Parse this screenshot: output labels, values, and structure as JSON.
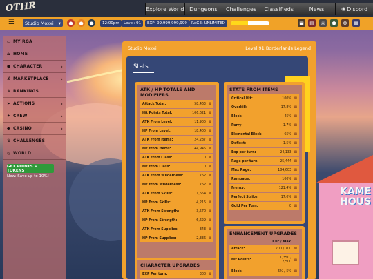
{
  "brand": {
    "logo": "OTHR"
  },
  "topnav": [
    {
      "label": "Explore World",
      "icon": ""
    },
    {
      "label": "Dungeons",
      "icon": ""
    },
    {
      "label": "Challenges",
      "icon": ""
    },
    {
      "label": "Classifieds",
      "icon": ""
    },
    {
      "label": "News",
      "icon": ""
    },
    {
      "label": "Discord",
      "icon": "discord-icon"
    }
  ],
  "toolbar": {
    "studio_select": "Studio Moxxi",
    "time": "12:00pm",
    "level": "Level: 91",
    "exp": "EXP: 99,999,999,999",
    "rage": "RAGE: UNLIMITED",
    "rage_fill_fraction": 0.45
  },
  "sidebar": {
    "items": [
      {
        "label": "MY RGA",
        "icon": "id-card-icon",
        "has_children": false
      },
      {
        "label": "HOME",
        "icon": "home-icon",
        "has_children": false
      },
      {
        "label": "CHARACTER",
        "icon": "user-icon",
        "has_children": true
      },
      {
        "label": "MARKETPLACE",
        "icon": "cart-icon",
        "has_children": true
      },
      {
        "label": "RANKINGS",
        "icon": "trophy-icon",
        "has_children": false
      },
      {
        "label": "ACTIONS",
        "icon": "send-icon",
        "has_children": true
      },
      {
        "label": "CREW",
        "icon": "crew-icon",
        "has_children": true
      },
      {
        "label": "CASINO",
        "icon": "casino-icon",
        "has_children": true
      },
      {
        "label": "CHALLENGES",
        "icon": "trophy-icon",
        "has_children": false
      },
      {
        "label": "WORLD",
        "icon": "globe-icon",
        "has_children": false
      }
    ],
    "points_button": "GET POINTS + TOKENS",
    "points_sub": "New: Save up to 10%!"
  },
  "panel": {
    "title": "Studio Moxxi",
    "subtitle": "Level 91 Borderlands Legend",
    "section_title": "Stats"
  },
  "atk_card": {
    "title": "ATK / HP TOTALS AND MODIFIERS",
    "rows": [
      {
        "label": "Attack Total:",
        "value": "58,463"
      },
      {
        "label": "Hit Points Total:",
        "value": "106,621"
      },
      {
        "label": "ATK From Level:",
        "value": "11,900"
      },
      {
        "label": "HP From Level:",
        "value": "18,400"
      },
      {
        "label": "ATK From Items:",
        "value": "24,287"
      },
      {
        "label": "HP From Items:",
        "value": "44,945"
      },
      {
        "label": "ATK From Class:",
        "value": "0"
      },
      {
        "label": "HP From Class:",
        "value": "0"
      },
      {
        "label": "ATK From Wilderness:",
        "value": "762"
      },
      {
        "label": "HP From Wilderness:",
        "value": "762"
      },
      {
        "label": "ATK From Skills:",
        "value": "1,654"
      },
      {
        "label": "HP From Skills:",
        "value": "4,215"
      },
      {
        "label": "ATK From Strength:",
        "value": "3,570"
      },
      {
        "label": "HP From Strength:",
        "value": "6,629"
      },
      {
        "label": "ATK From Supplies:",
        "value": "343"
      },
      {
        "label": "HP From Supplies:",
        "value": "2,336"
      }
    ]
  },
  "items_card": {
    "title": "STATS FROM ITEMS",
    "rows": [
      {
        "label": "Critical Hit:",
        "value": "100%"
      },
      {
        "label": "Overkill:",
        "value": "17.8%"
      },
      {
        "label": "Block:",
        "value": "45%"
      },
      {
        "label": "Parry:",
        "value": "1.7%"
      },
      {
        "label": "Elemental Block:",
        "value": "65%"
      },
      {
        "label": "Deflect:",
        "value": "1.5%"
      },
      {
        "label": "Exp per turn:",
        "value": "24,133"
      },
      {
        "label": "Rage per turn:",
        "value": "25,444"
      },
      {
        "label": "Max Rage:",
        "value": "184,603"
      },
      {
        "label": "Rampage:",
        "value": "100%"
      },
      {
        "label": "Frenzy:",
        "value": "121.4%"
      },
      {
        "label": "Perfect Strike:",
        "value": "17.0%"
      },
      {
        "label": "Gold Per Turn:",
        "value": "0"
      }
    ]
  },
  "char_card": {
    "title": "CHARACTER UPGRADES",
    "rows": [
      {
        "label": "EXP Per turn:",
        "value": "300"
      }
    ]
  },
  "enh_card": {
    "title": "ENHANCEMENT UPGRADES",
    "header": "Cur / Max",
    "rows": [
      {
        "label": "Attack:",
        "value": "700 / 700"
      },
      {
        "label": "Hit Points:",
        "value": "1,350 / 2,500"
      },
      {
        "label": "Block:",
        "value": "5% / 5%"
      }
    ]
  },
  "scenery": {
    "sign_line1": "KAME",
    "sign_line2": "HOUS"
  }
}
